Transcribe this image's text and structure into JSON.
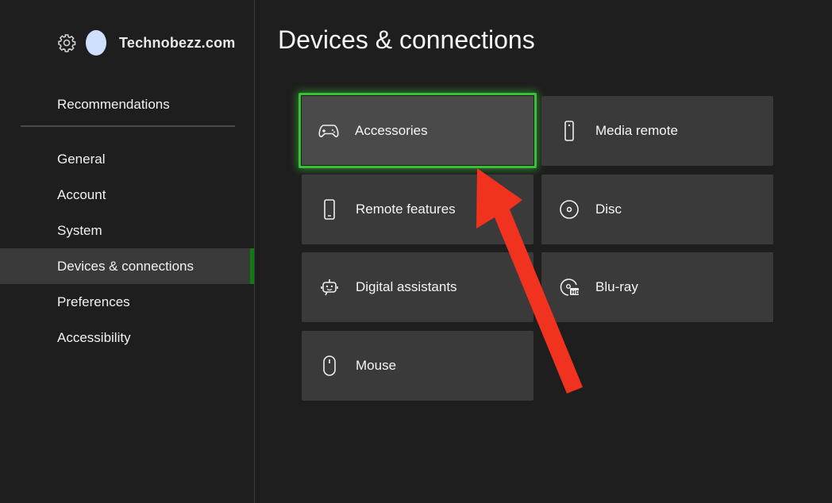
{
  "header": {
    "brand": "Technobezz.com",
    "settings_icon": "gear-icon",
    "avatar_color": "#cfe0ff"
  },
  "sidebar": {
    "recommendations": "Recommendations",
    "items": [
      {
        "label": "General"
      },
      {
        "label": "Account"
      },
      {
        "label": "System"
      },
      {
        "label": "Devices & connections",
        "active": true
      },
      {
        "label": "Preferences"
      },
      {
        "label": "Accessibility"
      }
    ],
    "accent": "#107c10"
  },
  "main": {
    "title": "Devices & connections",
    "tiles": [
      {
        "label": "Accessories",
        "icon": "gamepad-icon",
        "focused": true
      },
      {
        "label": "Media remote",
        "icon": "remote-icon"
      },
      {
        "label": "Remote features",
        "icon": "phone-icon"
      },
      {
        "label": "Disc",
        "icon": "disc-icon"
      },
      {
        "label": "Digital assistants",
        "icon": "assistant-icon"
      },
      {
        "label": "Blu-ray",
        "icon": "bluray-icon"
      },
      {
        "label": "Mouse",
        "icon": "mouse-icon"
      }
    ],
    "focus_color": "#36c234"
  },
  "annotation": {
    "arrow_color": "#f0321e"
  }
}
